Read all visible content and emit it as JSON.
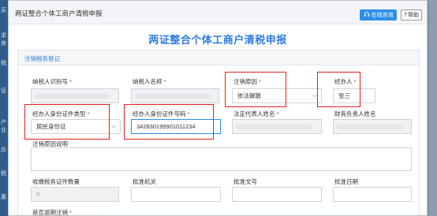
{
  "background": {
    "sidebar_fragments": [
      "买",
      "求务",
      "税",
      "证",
      "产业",
      "办",
      "税",
      "惠"
    ]
  },
  "window": {
    "title": "两证整合个体工商户清税申报",
    "online_button": "在线咨询",
    "help_button": "帮助"
  },
  "form": {
    "heading": "两证整合个体工商户清税申报",
    "section_title": "注销税务登记",
    "required_mark": "*",
    "taxpayer_id": {
      "label": "纳税人识别号",
      "value": ""
    },
    "taxpayer_name": {
      "label": "纳税人名称",
      "value": ""
    },
    "cancel_reason": {
      "label": "注销原因",
      "value": "依法解散"
    },
    "handler": {
      "label": "经办人",
      "value": "张三"
    },
    "handler_id_type": {
      "label": "经办人身份证件类型",
      "value": "居民身份证"
    },
    "handler_id_number": {
      "label": "经办人身份证件号码",
      "value": "342830199901011234"
    },
    "legal_rep": {
      "label": "法定代表人姓名",
      "value": ""
    },
    "finance_head": {
      "label": "财务负责人姓名",
      "value": ""
    },
    "cancel_reason_note": {
      "label": "注销原因说明",
      "value": ""
    },
    "cert_count": {
      "label": "收缴税务证件数量",
      "value": "0"
    },
    "approving_org": {
      "label": "批准机关",
      "value": ""
    },
    "approval_doc_no": {
      "label": "批准文号",
      "value": ""
    },
    "approval_date": {
      "label": "批准日期",
      "value": ""
    },
    "overdue_cancel": {
      "label": "是否逾期注销"
    }
  }
}
